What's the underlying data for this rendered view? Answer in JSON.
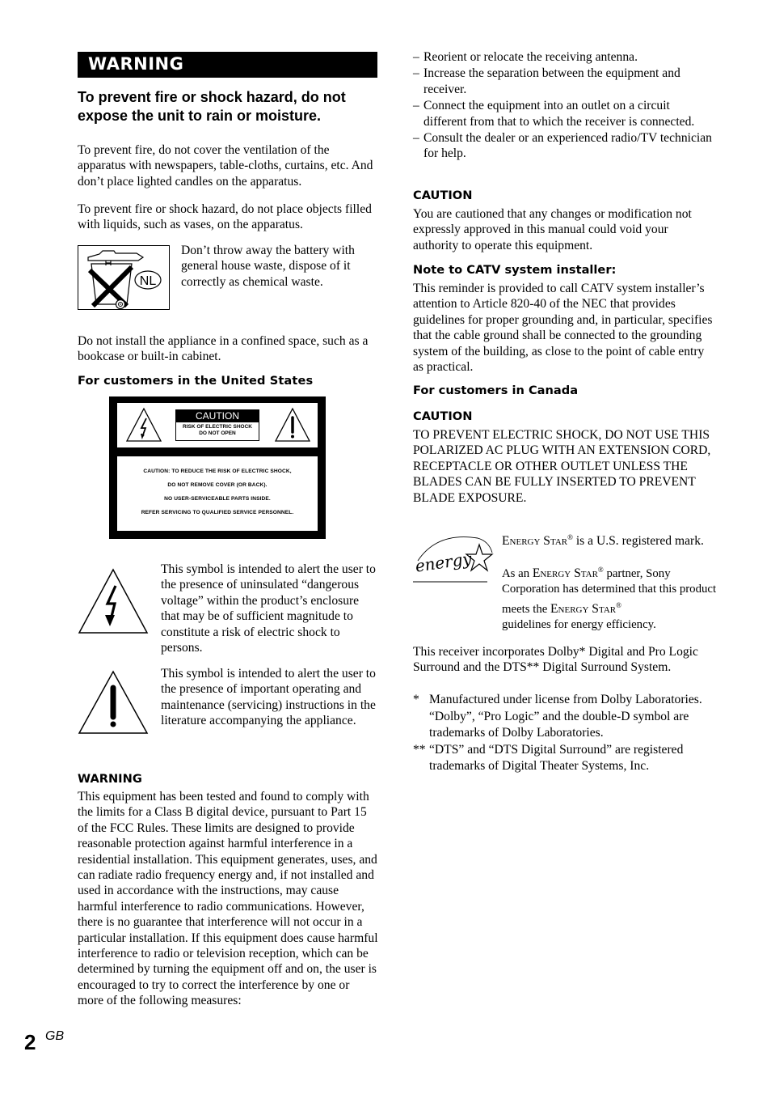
{
  "page": {
    "number": "2",
    "suffix": "GB"
  },
  "left": {
    "banner": "WARNING",
    "heading": "To prevent fire or shock hazard, do not expose the unit to rain or moisture.",
    "para_ventilation": "To prevent fire, do not cover the ventilation of the apparatus with newspapers, table-cloths, curtains, etc. And don’t place lighted candles on the apparatus.",
    "para_liquids": "To prevent fire or shock hazard, do not place objects filled with liquids, such as vases, on the apparatus.",
    "battery": {
      "icon": "crossed-out-bin-icon",
      "badge": "NL",
      "text": "Don’t throw away the battery with general house waste, dispose of it correctly as  chemical waste."
    },
    "para_confined": "Do not install the appliance in a confined space, such as a bookcase or built-in cabinet.",
    "us_heading": "For customers in the United States",
    "caution_label": {
      "title": "CAUTION",
      "sub_line1": "RISK OF ELECTRIC SHOCK",
      "sub_line2": "DO NOT OPEN",
      "lines": [
        "CAUTION: TO REDUCE THE RISK OF ELECTRIC SHOCK,",
        "DO NOT REMOVE COVER (OR BACK).",
        "NO USER-SERVICEABLE PARTS INSIDE.",
        "REFER SERVICING TO QUALIFIED SERVICE PERSONNEL."
      ]
    },
    "symbol_voltage_text": "This symbol is intended to alert the user to the presence of uninsulated “dangerous voltage” within the product’s enclosure that may be of sufficient magnitude to constitute a risk of electric shock to persons.",
    "symbol_exclaim_text": "This symbol is intended to alert the user to the presence of important operating and maintenance (servicing) instructions in the literature accompanying the appliance.",
    "fcc_heading": "WARNING",
    "fcc_text": "This equipment has been tested and found to comply with the limits for a Class B digital device, pursuant to Part 15 of the FCC Rules. These limits are designed to provide reasonable protection against harmful interference in a residential installation. This equipment generates, uses, and can radiate radio frequency energy and, if not installed and used in accordance with the instructions, may cause harmful interference to radio communications. However, there is no guarantee that interference will not occur in a particular installation. If this equipment does cause harmful interference to radio or television reception, which can be determined by turning the equipment off and on, the user is encouraged to try to correct the interference by one or more of the following measures:"
  },
  "right": {
    "measures": [
      "Reorient or relocate the receiving antenna.",
      "Increase the separation between the equipment and receiver.",
      "Connect the equipment into an outlet on a circuit different from that to which the receiver is connected.",
      "Consult the dealer or an experienced radio/TV technician for help."
    ],
    "dash": "–",
    "caution1_heading": "CAUTION",
    "caution1_text": "You are cautioned that any changes or modification not expressly approved in this manual could void your authority to operate this equipment.",
    "catv_heading": "Note to CATV system installer:",
    "catv_text": "This reminder is provided to call CATV system installer’s attention to Article 820-40 of the NEC that provides guidelines for proper grounding and, in particular, specifies that the cable ground shall be connected to the grounding system of the building, as close to the point of cable entry as practical.",
    "canada_heading": "For customers in Canada",
    "caution2_heading": "CAUTION",
    "caution2_text": "TO PREVENT ELECTRIC SHOCK, DO NOT USE THIS POLARIZED AC PLUG WITH AN EXTENSION CORD, RECEPTACLE OR OTHER OUTLET UNLESS THE BLADES CAN BE FULLY INSERTED TO PREVENT BLADE EXPOSURE.",
    "energy": {
      "logo_text": "energy",
      "brand": "Energy Star",
      "reg": "®",
      "para1_tail": " is a U.S. registered mark.",
      "para2_head": "As an ",
      "para2_mid": " partner, Sony Corporation has determined that this product meets the ",
      "para2_tail": "guidelines for energy efficiency."
    },
    "dolby_text": "This receiver incorporates Dolby* Digital and Pro Logic Surround and the DTS** Digital Surround System.",
    "footnotes": [
      {
        "mark": "*",
        "text": "Manufactured under license from Dolby Laboratories.",
        "sub": "“Dolby”, “Pro Logic” and the double-D symbol are trademarks of Dolby Laboratories."
      },
      {
        "mark": "**",
        "text": "“DTS” and “DTS Digital Surround” are registered trademarks of Digital Theater Systems, Inc."
      }
    ]
  }
}
